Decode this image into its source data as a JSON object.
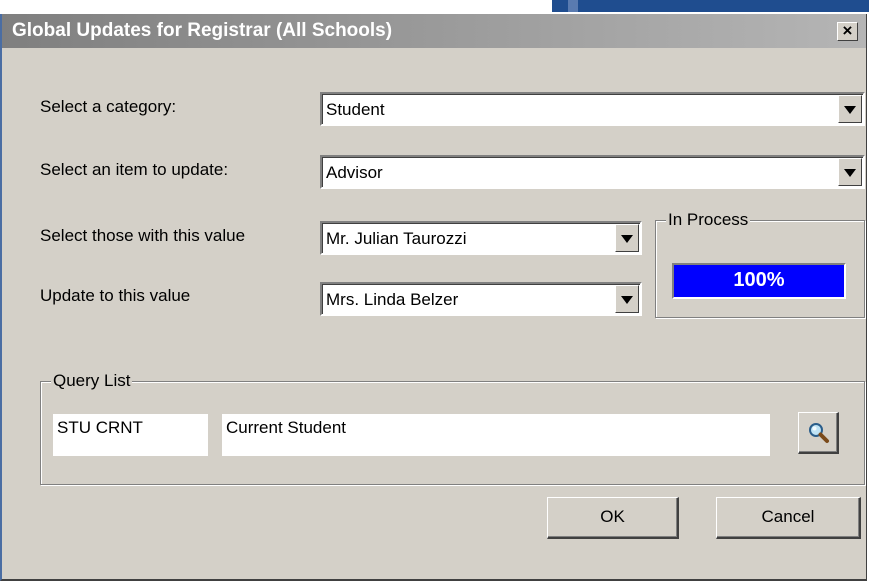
{
  "dialog": {
    "title": "Global Updates for Registrar (All Schools)",
    "close_glyph": "×",
    "close_icon": "close-icon"
  },
  "fields": {
    "category": {
      "label": "Select a category:",
      "value": "Student"
    },
    "item": {
      "label": "Select an item to update:",
      "value": "Advisor"
    },
    "with_value": {
      "label": "Select those with this value",
      "value": "Mr. Julian Taurozzi"
    },
    "update_to": {
      "label": "Update to this value",
      "value": "Mrs. Linda Belzer"
    }
  },
  "progress": {
    "caption": "In Process",
    "percent_text": "100%",
    "fraction": 1.0,
    "fill_color": "#0000ff"
  },
  "query_list": {
    "caption": "Query List",
    "code": "STU CRNT",
    "description": "Current Student",
    "search_icon": "magnifier-icon"
  },
  "buttons": {
    "ok": "OK",
    "cancel": "Cancel"
  }
}
